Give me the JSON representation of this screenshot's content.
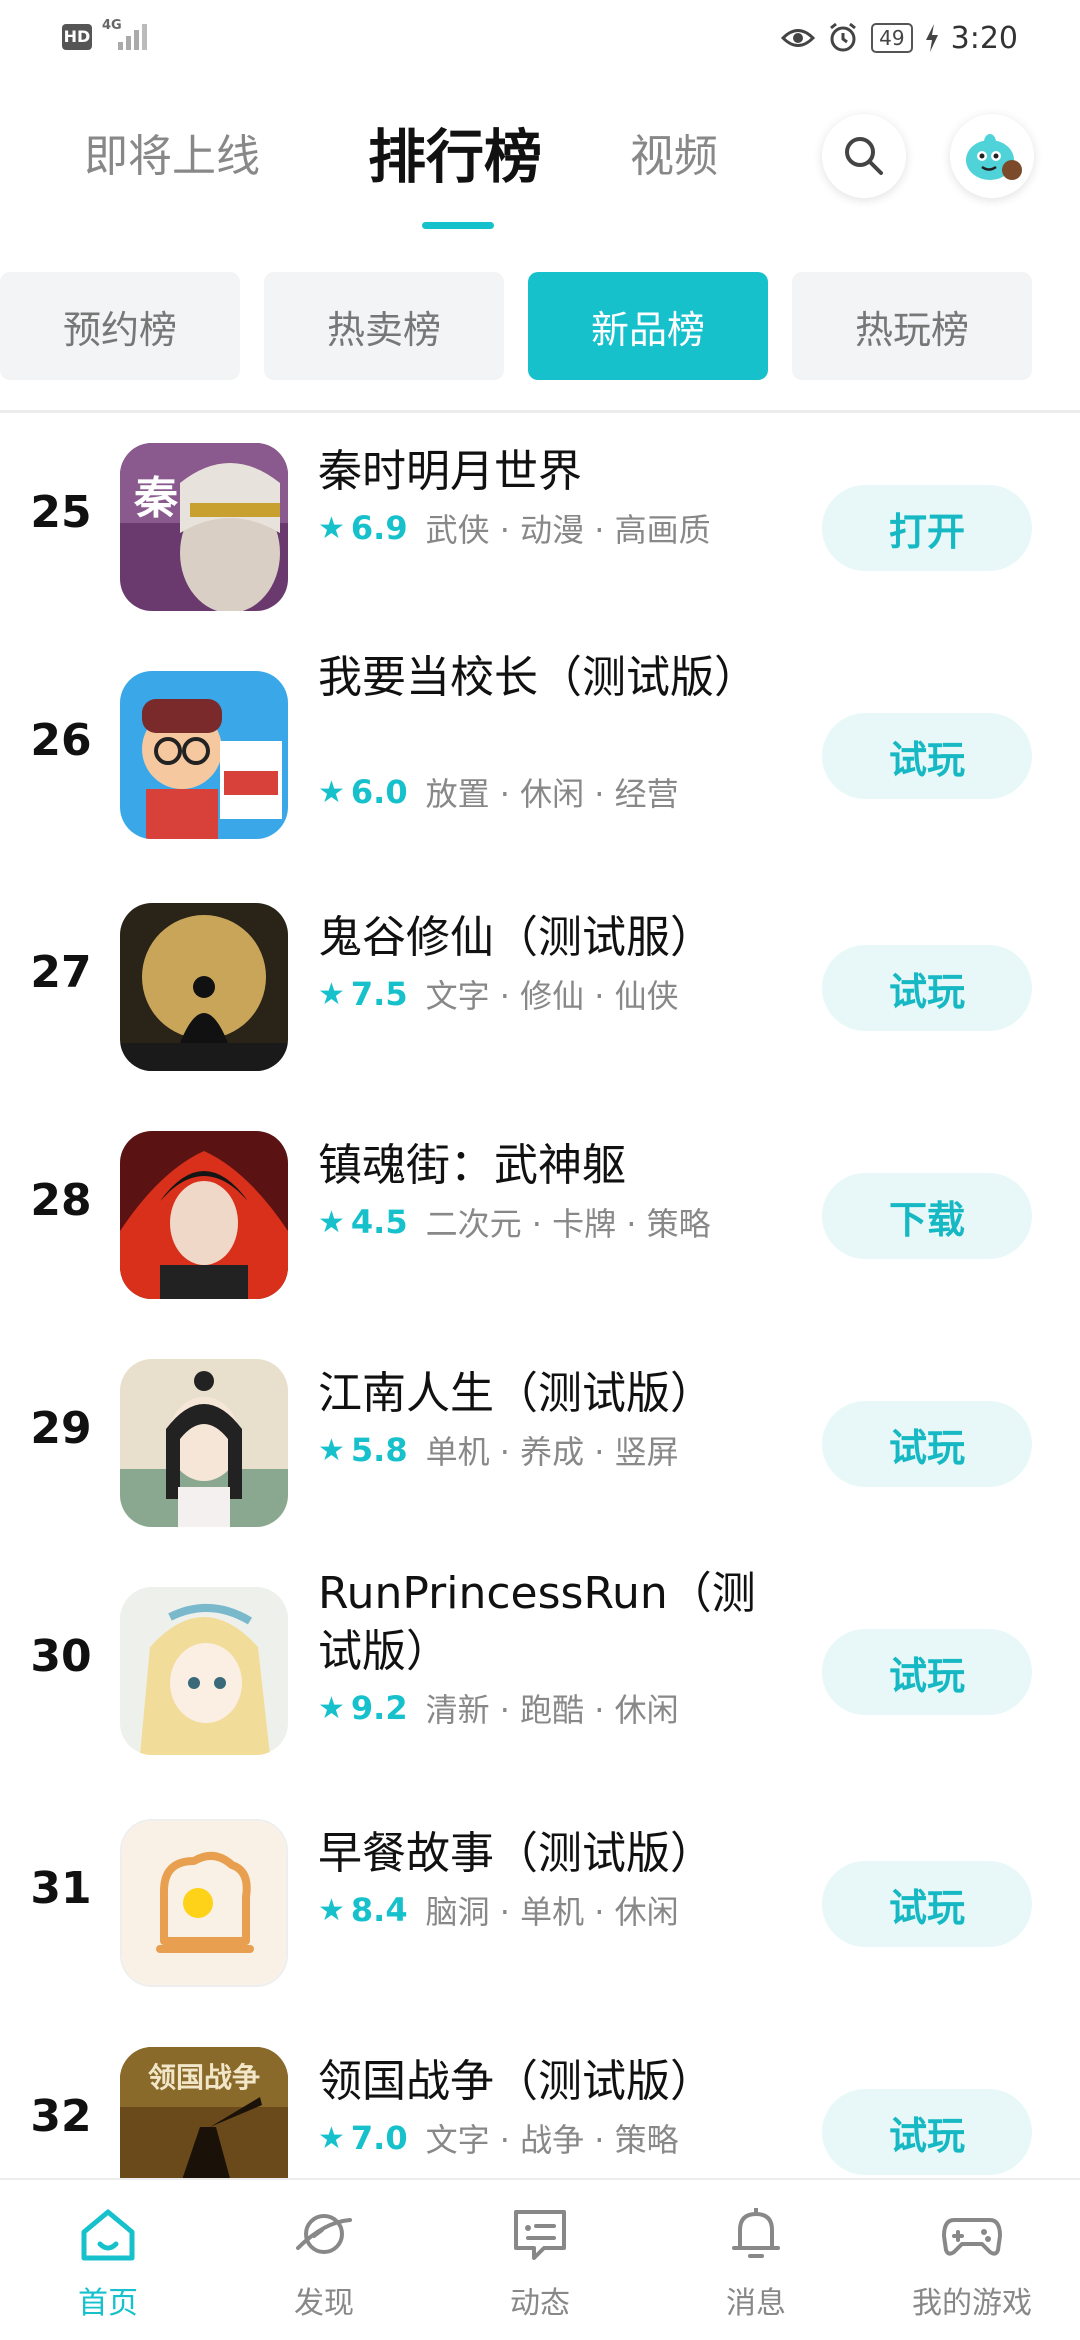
{
  "status_bar": {
    "hd": "HD",
    "network": "4G",
    "battery": "49",
    "time": "3:20"
  },
  "header": {
    "tabs": [
      {
        "label": "即将上线"
      },
      {
        "label": "排行榜"
      },
      {
        "label": "视频"
      }
    ],
    "active_tab": "排行榜"
  },
  "chips": [
    {
      "label": "预约榜"
    },
    {
      "label": "热卖榜"
    },
    {
      "label": "新品榜"
    },
    {
      "label": "热玩榜"
    }
  ],
  "active_chip": "新品榜",
  "games": [
    {
      "rank": "25",
      "title": "秦时明月世界",
      "score": "6.9",
      "tags": "武侠 · 动漫 · 高画质",
      "action": "打开"
    },
    {
      "rank": "26",
      "title": "我要当校长（测试版）",
      "score": "6.0",
      "tags": "放置 · 休闲 · 经营",
      "action": "试玩"
    },
    {
      "rank": "27",
      "title": "鬼谷修仙（测试服）",
      "score": "7.5",
      "tags": "文字 · 修仙 · 仙侠",
      "action": "试玩"
    },
    {
      "rank": "28",
      "title": "镇魂街：武神躯",
      "score": "4.5",
      "tags": "二次元 · 卡牌 · 策略",
      "action": "下载"
    },
    {
      "rank": "29",
      "title": "江南人生（测试版）",
      "score": "5.8",
      "tags": "单机 · 养成 · 竖屏",
      "action": "试玩"
    },
    {
      "rank": "30",
      "title": "RunPrincessRun（测试版）",
      "score": "9.2",
      "tags": "清新 · 跑酷 · 休闲",
      "action": "试玩"
    },
    {
      "rank": "31",
      "title": "早餐故事（测试版）",
      "score": "8.4",
      "tags": "脑洞 · 单机 · 休闲",
      "action": "试玩"
    },
    {
      "rank": "32",
      "title": "领国战争（测试版）",
      "score": "7.0",
      "tags": "文字 · 战争 · 策略",
      "action": "试玩",
      "icon_text": "领国战争"
    }
  ],
  "bottom_nav": [
    {
      "label": "首页",
      "icon": "home-icon"
    },
    {
      "label": "发现",
      "icon": "planet-icon"
    },
    {
      "label": "动态",
      "icon": "message-icon"
    },
    {
      "label": "消息",
      "icon": "bell-icon"
    },
    {
      "label": "我的游戏",
      "icon": "gamepad-icon"
    }
  ],
  "colors": {
    "accent": "#16c1cc",
    "accent_light": "#e8f8f9"
  }
}
